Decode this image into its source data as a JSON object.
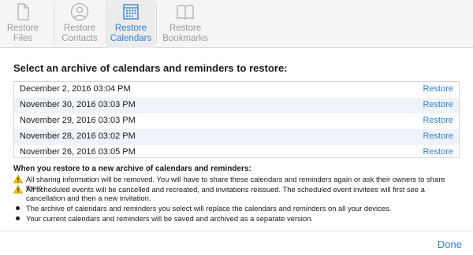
{
  "tabs": [
    {
      "label": "Restore\nFiles",
      "icon": "file-icon",
      "active": false
    },
    {
      "label": "Restore\nContacts",
      "icon": "contact-icon",
      "active": false
    },
    {
      "label": "Restore\nCalendars",
      "icon": "calendar-icon",
      "active": true
    },
    {
      "label": "Restore\nBookmarks",
      "icon": "book-icon",
      "active": false
    }
  ],
  "heading": "Select an archive of calendars and reminders to restore:",
  "archives": [
    {
      "date": "December 2, 2016 03:04 PM",
      "action": "Restore"
    },
    {
      "date": "November 30, 2016 03:03 PM",
      "action": "Restore"
    },
    {
      "date": "November 29, 2016 03:03 PM",
      "action": "Restore"
    },
    {
      "date": "November 28, 2016 03:02 PM",
      "action": "Restore"
    },
    {
      "date": "November 26, 2016 03:05 PM",
      "action": "Restore"
    }
  ],
  "info": {
    "title": "When you restore to a new archive of calendars and reminders:",
    "items": [
      {
        "type": "warning-icon",
        "text": "All sharing information will be removed. You will have to share these calendars and reminders again or ask their owners to share them."
      },
      {
        "type": "warning-icon",
        "text": "All scheduled events will be cancelled and recreated, and invitations reissued. The scheduled event invitees will first see a cancellation and then a new invitation."
      },
      {
        "type": "bullet",
        "text": "The archive of calendars and reminders you select will replace the calendars and reminders on all your devices."
      },
      {
        "type": "bullet",
        "text": "Your current calendars and reminders will be saved and archived as a separate version."
      }
    ]
  },
  "done_label": "Done",
  "colors": {
    "accent": "#2f7fd3",
    "warning": "#f2c200"
  }
}
